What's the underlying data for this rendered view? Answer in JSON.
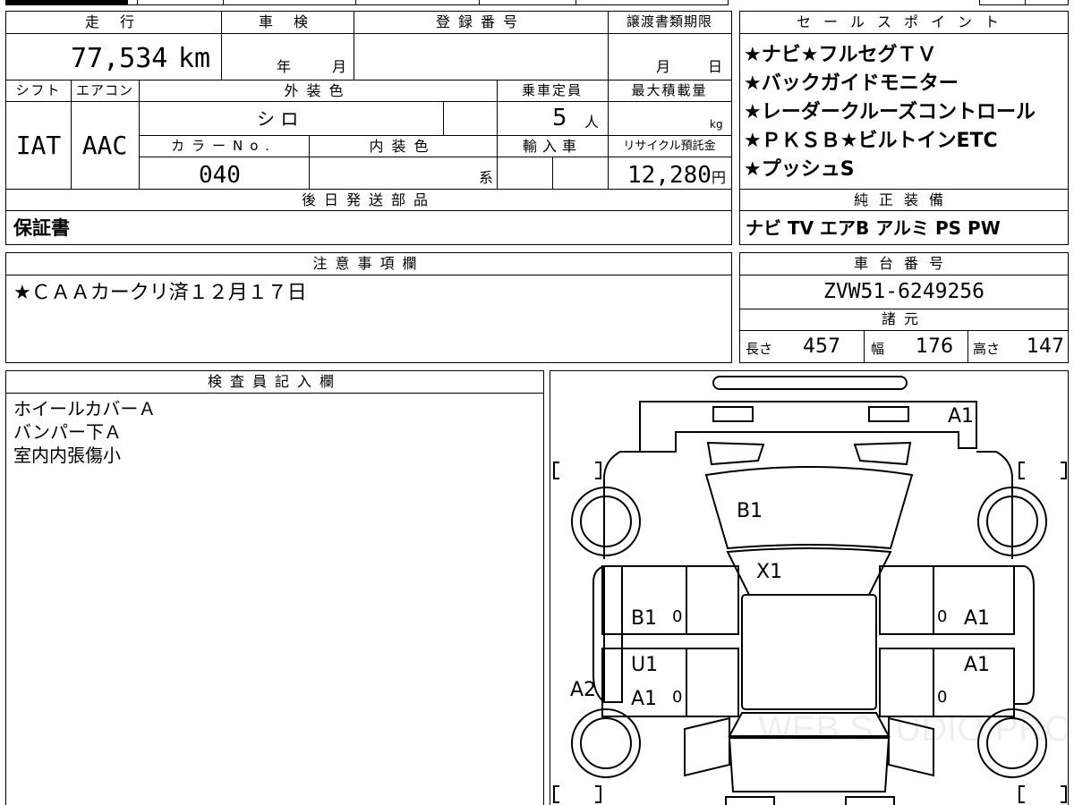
{
  "headers": {
    "mileage": "走 行",
    "shaken": "車 検",
    "registration": "登録番号",
    "transfer_deadline": "譲渡書類期限",
    "sales_points": "セールスポイント",
    "shift": "シフト",
    "aircon": "エアコン",
    "exterior_color": "外装色",
    "capacity": "乗車定員",
    "max_load": "最大積載量",
    "color_no": "カラーNo.",
    "interior_color": "内装色",
    "import": "輸入車",
    "recycle_deposit": "リサイクル預託金",
    "later_parts": "後日発送部品",
    "genuine_equipment": "純正装備",
    "notes": "注意事項欄",
    "chassis_number": "車台番号",
    "specs": "諸元",
    "inspector": "検査員記入欄"
  },
  "values": {
    "mileage": "77,534",
    "mileage_unit": "km",
    "shaken_year_unit": "年",
    "shaken_month_unit": "月",
    "transfer_month_unit": "月",
    "transfer_day_unit": "日",
    "shift": "IAT",
    "aircon": "AAC",
    "exterior_color": "シ ロ",
    "capacity": "5",
    "capacity_unit": "人",
    "max_load_unit": "kg",
    "color_no": "040",
    "interior_color_suffix": "系",
    "recycle_deposit": "12,280",
    "recycle_unit": "円",
    "later_parts": "保証書",
    "genuine_equipment": "ナビ TV エアB アルミ PS PW",
    "notes": "★ＣＡＡカークリ済１２月１７日",
    "chassis_number": "ZVW51-6249256",
    "length_label": "長さ",
    "length": "457",
    "width_label": "幅",
    "width": "176",
    "height_label": "高さ",
    "height": "147"
  },
  "sales_points": [
    "★ナビ★フルセグＴＶ",
    "★バックガイドモニター",
    "★レーダークルーズコントロール",
    "★ＰＫＳＢ★ビルトインETC",
    "★プッシュS"
  ],
  "inspector_notes": [
    "ホイールカバーＡ",
    "バンパー下Ａ",
    "室内内張傷小"
  ],
  "damage_marks": {
    "front_bumper": "A1",
    "hood": "B1",
    "windshield": "X1",
    "left_front_door": "B1",
    "right_front_door": "A1",
    "left_rear_door_top": "U1",
    "left_rear_door": "A1",
    "right_rear_door": "A1",
    "left_rocker": "A2",
    "zero_lf": "0",
    "zero_rf": "0",
    "zero_lr": "0",
    "zero_rr": "0"
  },
  "watermark": "WEB STUDIO PRO"
}
